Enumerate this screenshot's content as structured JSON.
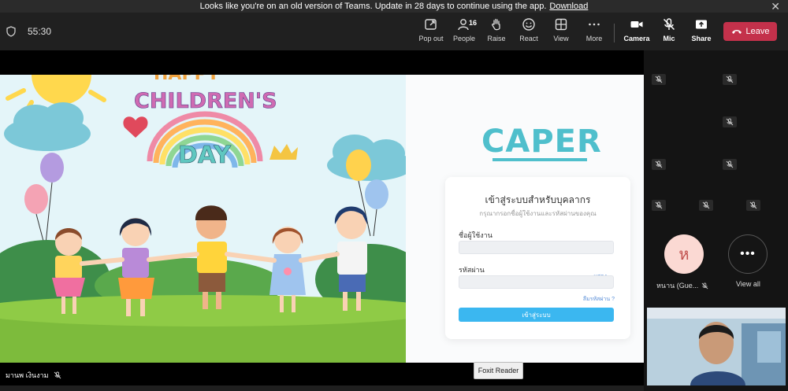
{
  "banner": {
    "message": "Looks like you're on an old version of Teams. Update in 28 days to continue using the app.",
    "link": "Download"
  },
  "toolbar": {
    "timer": "55:30",
    "popout": "Pop out",
    "people": "People",
    "people_count": "16",
    "raise": "Raise",
    "react": "React",
    "view": "View",
    "more": "More",
    "camera": "Camera",
    "mic": "Mic",
    "share": "Share",
    "leave": "Leave"
  },
  "shared_screen": {
    "illustration_title_top": "HAPPY",
    "illustration_title_mid": "CHILDREN'S",
    "illustration_title_bottom": "DAY",
    "logo": "CAPER",
    "login": {
      "title": "เข้าสู่ระบบสำหรับบุคลากร",
      "subtitle": "กรุณากรอกชื่อผู้ใช้งานและรหัสผ่านของคุณ",
      "username_label": "ชื่อผู้ใช้งาน",
      "password_label": "รหัสผ่าน",
      "show_label": "แสดง",
      "forgot_label": "ลืมรหัสผ่าน ?",
      "submit_label": "เข้าสู่ระบบ"
    }
  },
  "presenter_name": "มานพ เงินงาม",
  "foxit_tooltip": "Foxit Reader",
  "gallery": {
    "avatar_initial": "ห",
    "guest_name": "หนาน (Gue...",
    "view_all": "View all"
  },
  "colors": {
    "leave": "#c4314b",
    "brand": "#4fbfcc",
    "submit": "#3bb7f0"
  }
}
